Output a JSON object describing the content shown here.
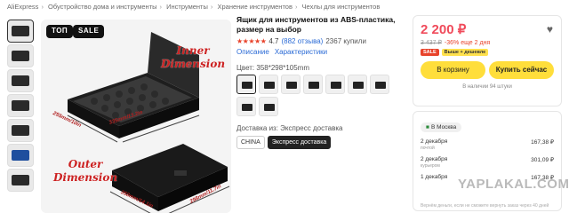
{
  "breadcrumb": [
    "AliExpress",
    "Обустройство дома и инструменты",
    "Инструменты",
    "Хранение инструментов",
    "Чехлы для инструментов"
  ],
  "gallery": {
    "badges": [
      "ТОП",
      "SALE"
    ],
    "annotations": {
      "inner": "Inner\nDimension",
      "outer": "Outer\nDimension",
      "dim_inner_depth": "255mm/10in",
      "dim_inner_width": "335mm/13.2in",
      "dim_outer_width": "358mm/14.1in",
      "dim_outer_depth": "298mm/11.7in"
    }
  },
  "product": {
    "title": "Ящик для инструментов из ABS-пластика, размер на выбор",
    "stars": "★★★★★",
    "rating": "4.7",
    "reviews": "(882 отзыва)",
    "sold": "2367 купили",
    "tab_description": "Описание",
    "tab_specs": "Характеристики",
    "color_label": "Цвет:",
    "color_value": "358*298*105mm",
    "shipping_label": "Доставка из:",
    "shipping_value": "Экспресс доставка",
    "shipping_options": [
      "CHINA",
      "Экспресс доставка"
    ]
  },
  "buy": {
    "price": "2 200 ₽",
    "old_price": "3 437 ₽",
    "discount": "-36% еще 2 дня",
    "tags": [
      "SALE",
      "Выше + дешевле"
    ],
    "cart_label": "В корзину",
    "buy_now_label": "Купить сейчас",
    "stock": "В наличии 94 штуки"
  },
  "delivery": {
    "city": "В Москва",
    "rows": [
      {
        "date": "2 декабря",
        "sub": "почтой",
        "price": "167,38 ₽"
      },
      {
        "date": "2 декабря",
        "sub": "курьером",
        "price": "301,09 ₽"
      },
      {
        "date": "1 декабря",
        "sub": "",
        "price": "167,38 ₽"
      }
    ],
    "footer": "Вернём деньги, если не сможете вернуть заказ через 40 дней"
  },
  "watermark": "YAPLAKAL.COM",
  "colors": {
    "accent": "#f04b5b",
    "button": "#ffde3b",
    "link": "#2b6bd6"
  }
}
